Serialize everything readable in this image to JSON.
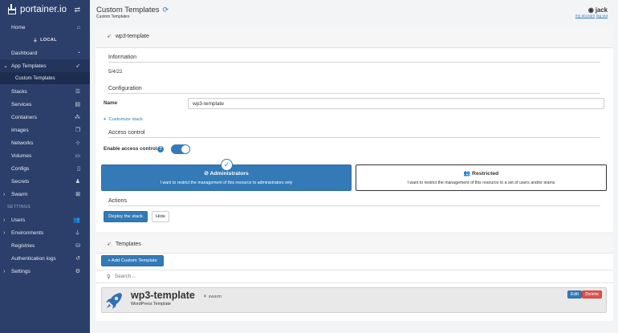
{
  "sidebar": {
    "logo_text": "portainer.io",
    "endpoint_label": "LOCAL",
    "section_settings": "SETTINGS",
    "items": {
      "home": "Home",
      "dashboard": "Dashboard",
      "app_templates": "App Templates",
      "custom_templates": "Custom Templates",
      "stacks": "Stacks",
      "services": "Services",
      "containers": "Containers",
      "images": "Images",
      "networks": "Networks",
      "volumes": "Volumes",
      "configs": "Configs",
      "secrets": "Secrets",
      "swarm": "Swarm",
      "users": "Users",
      "environments": "Environments",
      "registries": "Registries",
      "authentication_logs": "Authentication logs",
      "settings": "Settings"
    }
  },
  "header": {
    "title": "Custom Templates",
    "breadcrumb": "Custom Templates",
    "username": "jack",
    "my_account": "my account",
    "log_out": "log out"
  },
  "form_panel": {
    "title": "wp3-template",
    "information_title": "Information",
    "information_value": "5/4/22",
    "configuration_title": "Configuration",
    "name_label": "Name",
    "name_value": "wp3-template",
    "customize_stack": "Customize stack",
    "access_control_title": "Access control",
    "enable_access_control_label": "Enable access control",
    "access_control_enabled": true,
    "admins_option_title": "Administrators",
    "admins_option_desc": "I want to restrict the management of this resource to administrators only",
    "restricted_option_title": "Restricted",
    "restricted_option_desc": "I want to restrict the management of this resource to a set of users and/or teams",
    "actions_title": "Actions",
    "deploy_button": "Deploy the stack",
    "hide_button": "Hide"
  },
  "templates_panel": {
    "title": "Templates",
    "add_button": "+ Add Custom Template",
    "search_placeholder": "Search...",
    "templates": [
      {
        "name": "wp3-template",
        "platform": "swarm",
        "description": "WordPress Template",
        "edit_label": "Edit",
        "delete_label": "Delete"
      }
    ]
  },
  "colors": {
    "sidebar_bg": "#2c3f6a",
    "primary": "#337ab7",
    "danger": "#d9534f"
  }
}
